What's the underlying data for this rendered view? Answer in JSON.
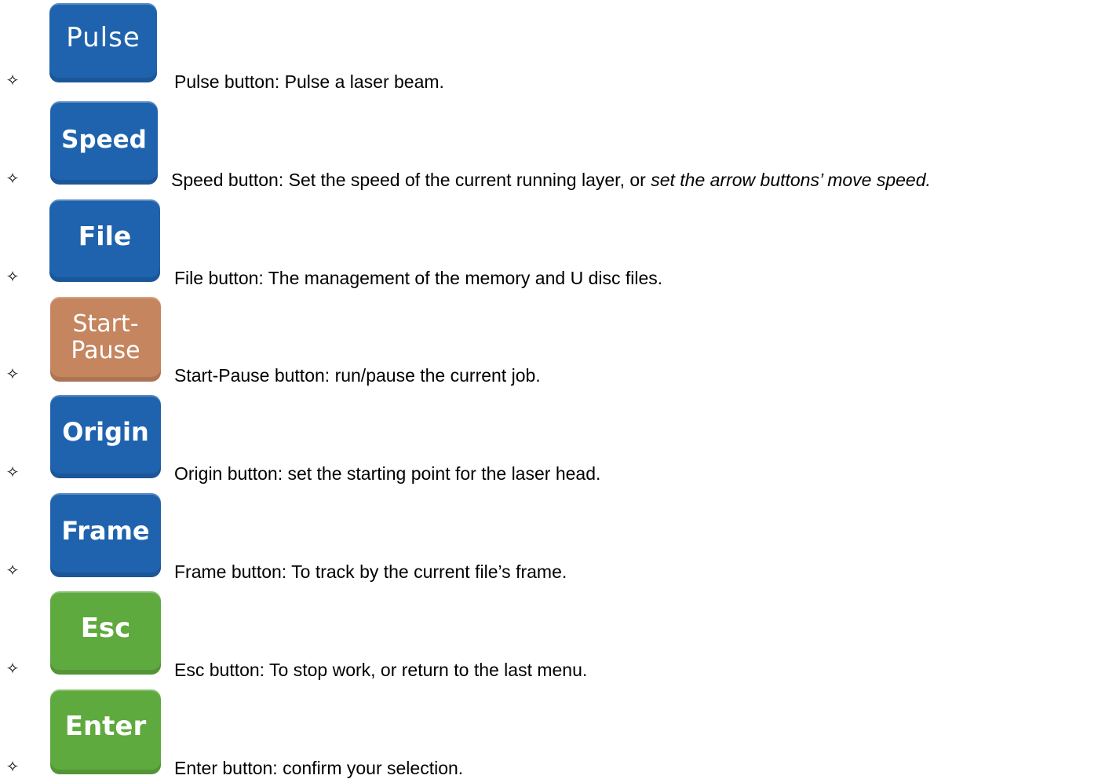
{
  "bullet_symbol": "✧",
  "colors": {
    "blue": "#1f63ae",
    "tan": "#c4855f",
    "green": "#5faa3e"
  },
  "items": [
    {
      "key_label": "Pulse",
      "description": "Pulse button: Pulse a laser beam.",
      "key_color": "blue"
    },
    {
      "key_label": "Speed",
      "description": "Speed button: Set the speed of the current running layer, or ",
      "description_italic": "set the arrow buttons’ move speed.",
      "key_color": "blue"
    },
    {
      "key_label": "File",
      "description": "File button: The management of the memory and U disc files.",
      "key_color": "blue"
    },
    {
      "key_label": "Start-",
      "key_label_line2": "Pause",
      "description": "Start-Pause button: run/pause the current job.",
      "key_color": "tan"
    },
    {
      "key_label": "Origin",
      "description": "Origin button: set the starting point for the laser head.",
      "key_color": "blue"
    },
    {
      "key_label": "Frame",
      "description": "Frame button: To track by the current file’s frame.",
      "key_color": "blue"
    },
    {
      "key_label": "Esc",
      "description": "Esc button: To stop work, or return to the last menu.",
      "key_color": "green"
    },
    {
      "key_label": "Enter",
      "description": "Enter button: confirm your selection.",
      "key_color": "green"
    }
  ]
}
